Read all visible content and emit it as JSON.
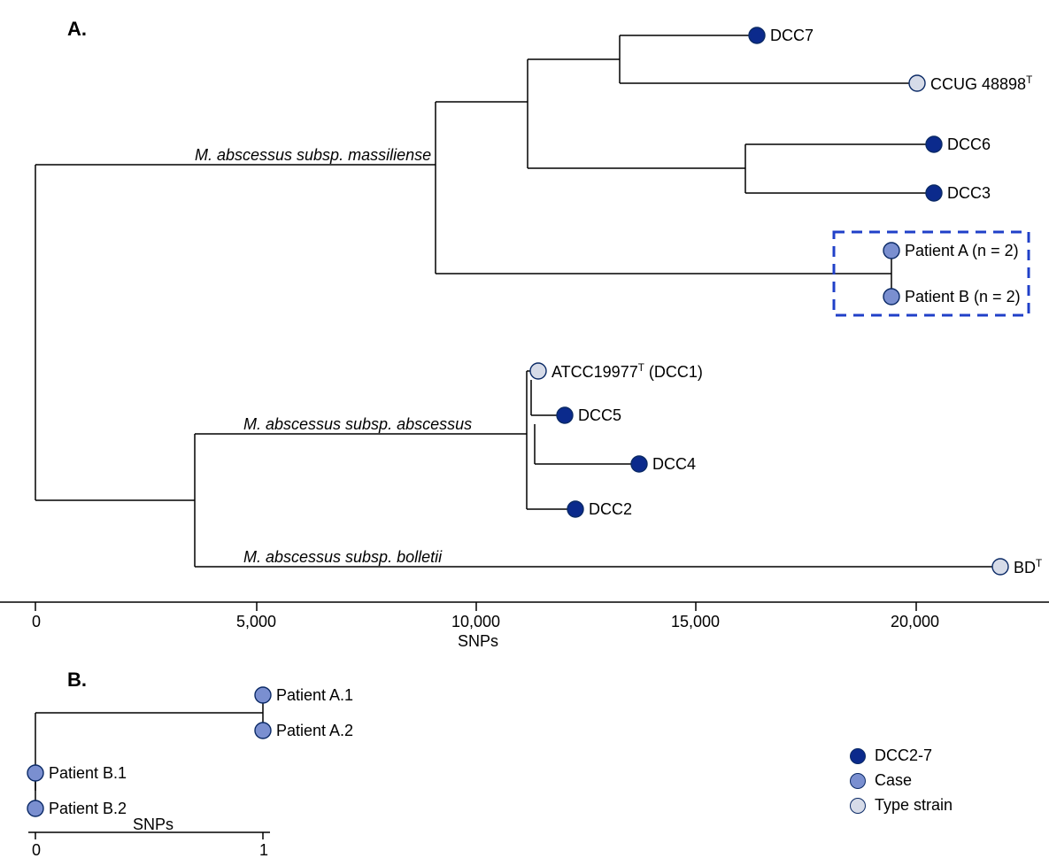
{
  "panelA": {
    "label": "A.",
    "cladeLabels": {
      "massiliense": "M. abscessus subsp. massiliense",
      "abscessus": "M. abscessus subsp. abscessus",
      "bolletii": "M. abscessus subsp. bolletii"
    },
    "tips": {
      "dcc7": "DCC7",
      "ccug": "CCUG 48898",
      "ccug_sup": "T",
      "dcc6": "DCC6",
      "dcc3": "DCC3",
      "patientA": "Patient A (n = 2)",
      "patientB": "Patient B (n = 2)",
      "atcc": "ATCC19977",
      "atcc_sup": "T",
      "atcc_tail": " (DCC1)",
      "dcc5": "DCC5",
      "dcc4": "DCC4",
      "dcc2": "DCC2",
      "bd": "BD",
      "bd_sup": "T"
    },
    "axis": {
      "title": "SNPs",
      "ticks": [
        "0",
        "5,000",
        "10,000",
        "15,000",
        "20,000"
      ]
    }
  },
  "panelB": {
    "label": "B.",
    "tips": {
      "patientA1": "Patient A.1",
      "patientA2": "Patient A.2",
      "patientB1": "Patient B.1",
      "patientB2": "Patient B.2"
    },
    "axis": {
      "title": "SNPs",
      "ticks": [
        "0",
        "1"
      ]
    }
  },
  "legend": {
    "dcc": "DCC2-7",
    "case": "Case",
    "type": "Type strain"
  },
  "chart_data": {
    "type": "phylogram",
    "panels": [
      {
        "id": "A",
        "x_axis": {
          "label": "SNPs",
          "ticks": [
            0,
            5000,
            10000,
            15000,
            20000
          ],
          "range": [
            0,
            22500
          ]
        },
        "clades": [
          {
            "name": "M. abscessus subsp. massiliense",
            "tips": [
              {
                "label": "DCC7",
                "category": "DCC2-7",
                "snps": 17100
              },
              {
                "label": "CCUG 48898^T",
                "category": "Type strain",
                "snps": 20700
              },
              {
                "label": "DCC6",
                "category": "DCC2-7",
                "snps": 20900
              },
              {
                "label": "DCC3",
                "category": "DCC2-7",
                "snps": 20900
              },
              {
                "label": "Patient A (n = 2)",
                "category": "Case",
                "snps": 20700,
                "clustered_with": "Patient B",
                "cluster_box": true
              },
              {
                "label": "Patient B (n = 2)",
                "category": "Case",
                "snps": 20700,
                "clustered_with": "Patient A",
                "cluster_box": true
              }
            ]
          },
          {
            "name": "M. abscessus subsp. abscessus",
            "tips": [
              {
                "label": "ATCC19977^T (DCC1)",
                "category": "Type strain",
                "snps": 12300
              },
              {
                "label": "DCC5",
                "category": "DCC2-7",
                "snps": 12700
              },
              {
                "label": "DCC4",
                "category": "DCC2-7",
                "snps": 14400
              },
              {
                "label": "DCC2",
                "category": "DCC2-7",
                "snps": 12900
              }
            ]
          },
          {
            "name": "M. abscessus subsp. bolletii",
            "tips": [
              {
                "label": "BD^T",
                "category": "Type strain",
                "snps": 22200
              }
            ]
          }
        ]
      },
      {
        "id": "B",
        "x_axis": {
          "label": "SNPs",
          "ticks": [
            0,
            1
          ],
          "range": [
            0,
            1
          ]
        },
        "tips": [
          {
            "label": "Patient A.1",
            "category": "Case",
            "snps": 1
          },
          {
            "label": "Patient A.2",
            "category": "Case",
            "snps": 1
          },
          {
            "label": "Patient B.1",
            "category": "Case",
            "snps": 0
          },
          {
            "label": "Patient B.2",
            "category": "Case",
            "snps": 0
          }
        ],
        "note": "Patient A isolates differ by 1 SNP from Patient B isolates; within-patient isolates are identical."
      }
    ],
    "legend": [
      {
        "label": "DCC2-7",
        "swatch": "dark-blue"
      },
      {
        "label": "Case",
        "swatch": "mid-blue"
      },
      {
        "label": "Type strain",
        "swatch": "light-grey"
      }
    ]
  }
}
